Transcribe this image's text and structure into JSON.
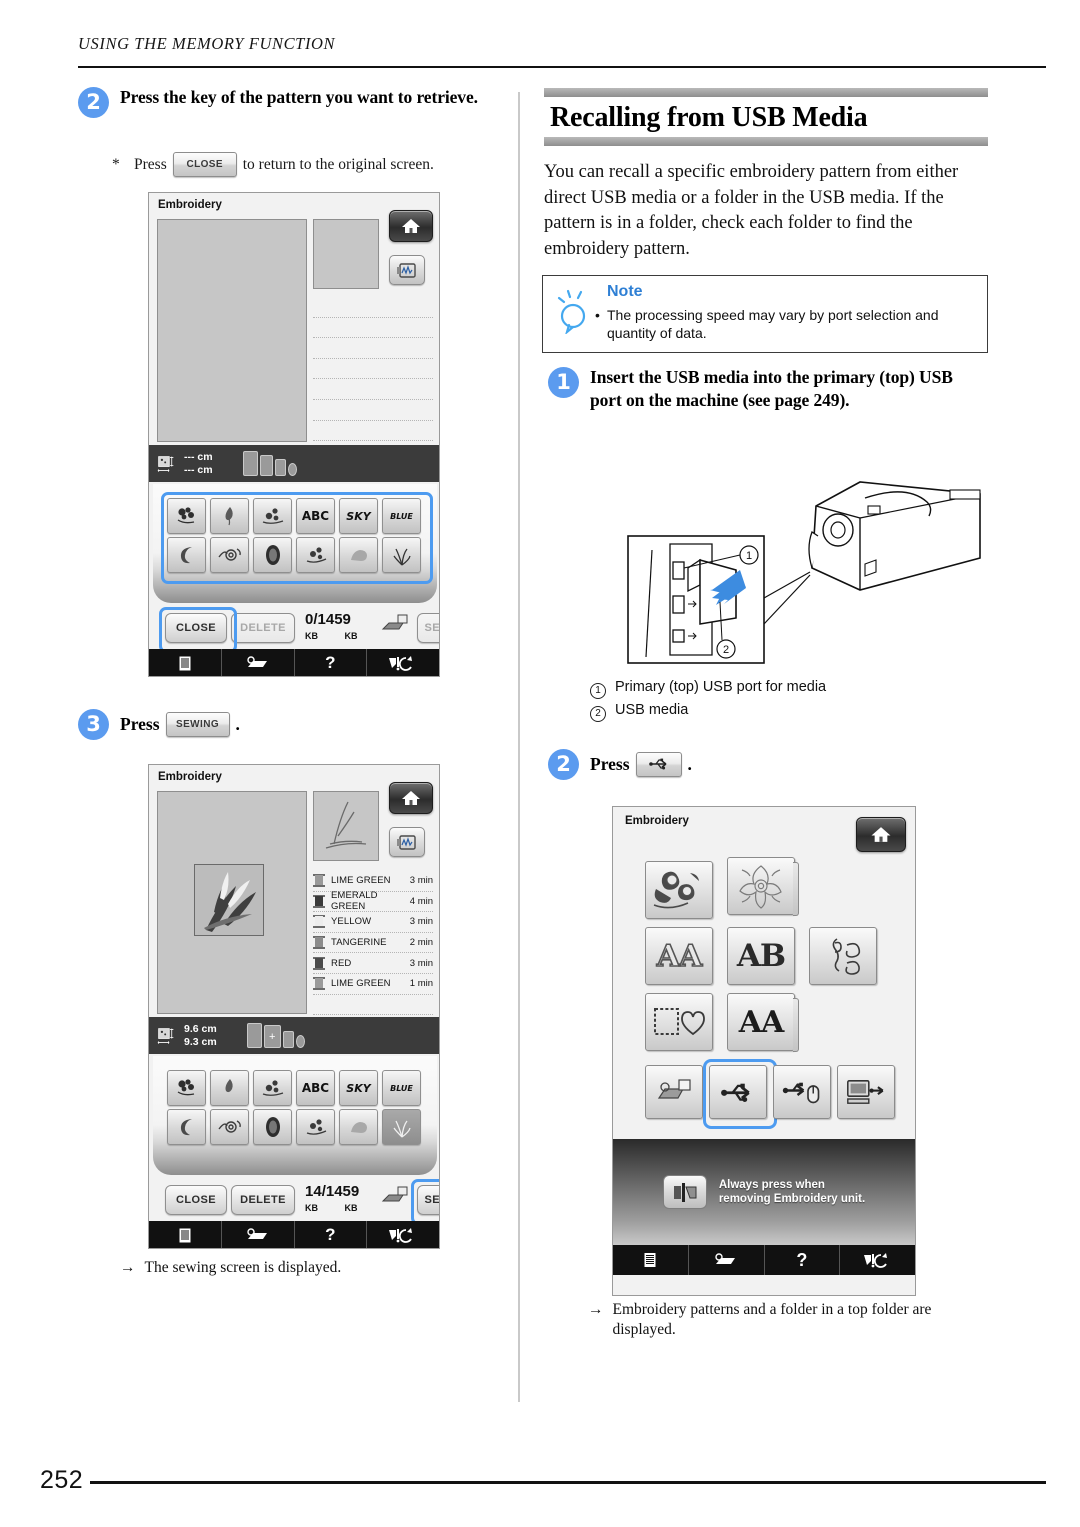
{
  "running_head": "USING THE MEMORY FUNCTION",
  "page_number": "252",
  "left_column": {
    "step2": {
      "number": "2",
      "text": "Press the key of the pattern you want to retrieve."
    },
    "hint": {
      "asterisk": "*",
      "before": "Press",
      "key_label": "CLOSE",
      "after": "to return to the original screen."
    },
    "screen1": {
      "title": "Embroidery",
      "home_icon": "home-icon",
      "preview_icon": "pattern-preview-icon",
      "size_width": "--- cm",
      "size_height": "--- cm",
      "pattern_keys": [
        {
          "label": "",
          "icon": "floral-pattern-icon"
        },
        {
          "label": "",
          "icon": "leaf-pattern-icon"
        },
        {
          "label": "",
          "icon": "flower-spray-icon"
        },
        {
          "label": "ABC",
          "icon": "abc-alphabet-icon"
        },
        {
          "label": "SKY",
          "icon": "sky-script-icon"
        },
        {
          "label": "BLUE",
          "icon": "blue-script-icon"
        },
        {
          "label": "",
          "icon": "crescent-pattern-icon"
        },
        {
          "label": "",
          "icon": "swirl-pattern-icon"
        },
        {
          "label": "",
          "icon": "oval-pattern-icon"
        },
        {
          "label": "",
          "icon": "bouquet-pattern-icon"
        },
        {
          "label": "",
          "icon": "shape-pattern-icon"
        },
        {
          "label": "",
          "icon": "grass-pattern-icon"
        }
      ],
      "buttons": {
        "close": "CLOSE",
        "delete": "DELETE",
        "sewing": "SEWING"
      },
      "memory_used": "0",
      "memory_total": "1459",
      "memory_unit": "KB",
      "taskbar": [
        "document-icon",
        "machine-icon",
        "help-icon",
        "needle-info-icon"
      ]
    },
    "step3": {
      "number": "3",
      "before": "Press",
      "key_label": "SEWING",
      "after": "."
    },
    "screen2": {
      "title": "Embroidery",
      "home_icon": "home-icon",
      "preview_icon": "pattern-preview-icon",
      "size_width": "9.6 cm",
      "size_height": "9.3 cm",
      "threads": [
        {
          "name": "LIME GREEN",
          "time": "3 min",
          "color": "#9a9a9a"
        },
        {
          "name": "EMERALD GREEN",
          "time": "4 min",
          "color": "#3a3a3a"
        },
        {
          "name": "YELLOW",
          "time": "3 min",
          "color": "#ededed"
        },
        {
          "name": "TANGERINE",
          "time": "2 min",
          "color": "#8c8c8c"
        },
        {
          "name": "RED",
          "time": "3 min",
          "color": "#4a4a4a"
        },
        {
          "name": "LIME GREEN",
          "time": "1 min",
          "color": "#9a9a9a"
        }
      ],
      "pattern_keys": [
        {
          "label": "",
          "icon": "floral-pattern-icon"
        },
        {
          "label": "",
          "icon": "leaf-pattern-icon"
        },
        {
          "label": "",
          "icon": "flower-spray-icon"
        },
        {
          "label": "ABC",
          "icon": "abc-alphabet-icon"
        },
        {
          "label": "SKY",
          "icon": "sky-script-icon"
        },
        {
          "label": "BLUE",
          "icon": "blue-script-icon"
        },
        {
          "label": "",
          "icon": "crescent-pattern-icon"
        },
        {
          "label": "",
          "icon": "swirl-pattern-icon"
        },
        {
          "label": "",
          "icon": "oval-pattern-icon"
        },
        {
          "label": "",
          "icon": "bouquet-pattern-icon"
        },
        {
          "label": "",
          "icon": "shape-pattern-icon"
        },
        {
          "label": "",
          "icon": "grass-pattern-icon"
        }
      ],
      "buttons": {
        "close": "CLOSE",
        "delete": "DELETE",
        "sewing": "SEWING"
      },
      "memory_used": "14",
      "memory_total": "1459",
      "memory_unit": "KB"
    },
    "result": {
      "arrow": "→",
      "text": "The sewing screen is displayed."
    }
  },
  "right_column": {
    "section_title": "Recalling from USB Media",
    "intro": "You can recall a specific embroidery pattern from either direct USB media or a folder in the USB media. If the pattern is in a folder, check each folder to find the embroidery pattern.",
    "note": {
      "icon": "lightbulb-icon",
      "title": "Note",
      "bullet": "•",
      "text": "The processing speed may vary by port selection and quantity of data."
    },
    "step1": {
      "number": "1",
      "text": "Insert the USB media into the primary (top) USB port on the machine (see page 249)."
    },
    "illustration": {
      "callout_1": "1",
      "callout_2": "2",
      "legend": [
        {
          "num": "①",
          "text": "Primary (top) USB port for media"
        },
        {
          "num": "②",
          "text": "USB media"
        }
      ]
    },
    "step2": {
      "number": "2",
      "before": "Press",
      "key_icon": "usb-icon",
      "after": "."
    },
    "screen3": {
      "title": "Embroidery",
      "home_icon": "home-icon",
      "items": [
        {
          "icon": "sunflower-pattern-icon",
          "type": "pattern",
          "label": ""
        },
        {
          "icon": "floral-square-icon",
          "type": "folder",
          "label": ""
        },
        {
          "icon": "aa-outline-icon",
          "type": "pattern",
          "label": "AA"
        },
        {
          "icon": "ab-serif-icon",
          "type": "pattern",
          "label": "AB"
        },
        {
          "icon": "monogram-swirl-icon",
          "type": "pattern",
          "label": ""
        },
        {
          "icon": "frame-heart-icon",
          "type": "pattern",
          "label": ""
        },
        {
          "icon": "aa-bold-icon",
          "type": "folder",
          "label": "AA"
        }
      ],
      "source_keys": [
        {
          "icon": "machine-memory-icon",
          "selected": false
        },
        {
          "icon": "usb-icon",
          "selected": true
        },
        {
          "icon": "usb-mouse-icon",
          "selected": false
        },
        {
          "icon": "computer-usb-icon",
          "selected": false
        }
      ],
      "banner": {
        "icon": "embroidery-unit-icon",
        "line1": "Always press when",
        "line2": "removing Embroidery unit."
      },
      "taskbar": [
        "document-icon",
        "machine-icon",
        "help-icon",
        "needle-info-icon"
      ]
    },
    "result": {
      "arrow": "→",
      "text": "Embroidery patterns and a folder in a top folder are displayed."
    }
  },
  "colors": {
    "accent_blue": "#5b9bef",
    "selection_blue": "#4d9bf0",
    "note_blue": "#2e7fd4",
    "lcd_bg": "#f2f2f2",
    "lcd_dark": "#3b3b3b"
  }
}
